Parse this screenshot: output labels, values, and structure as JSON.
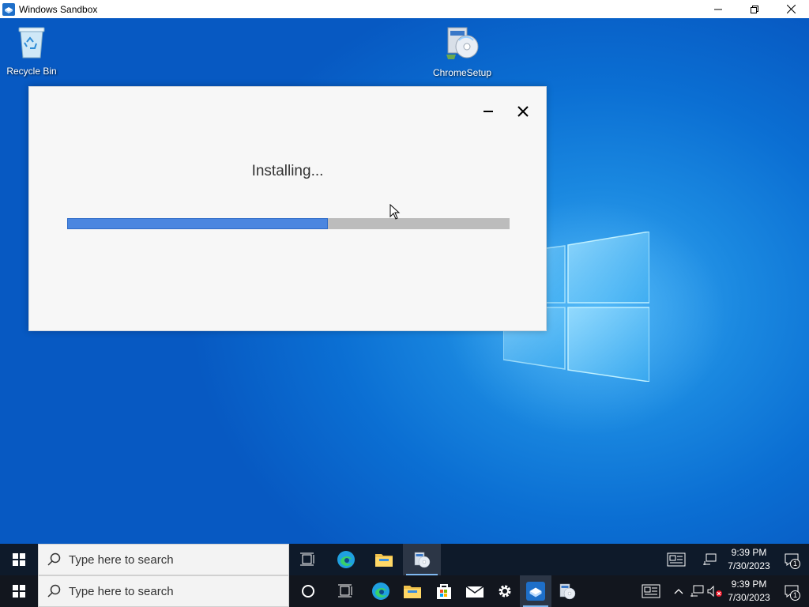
{
  "window": {
    "title": "Windows Sandbox"
  },
  "desktop": {
    "icons": [
      {
        "label": "Recycle Bin",
        "icon": "recycle-bin-icon"
      },
      {
        "label": "ChromeSetup",
        "icon": "installer-icon"
      }
    ]
  },
  "installer": {
    "status": "Installing...",
    "progress": 0.59,
    "colors": {
      "fill": "#4a86e0",
      "track": "#bcbcbc"
    }
  },
  "taskbar_inner": {
    "search_placeholder": "Type here to search",
    "time": "9:39 PM",
    "date": "7/30/2023",
    "notification_count": "1"
  },
  "taskbar_outer": {
    "search_placeholder": "Type here to search",
    "time": "9:39 PM",
    "date": "7/30/2023",
    "notification_count": "1"
  }
}
